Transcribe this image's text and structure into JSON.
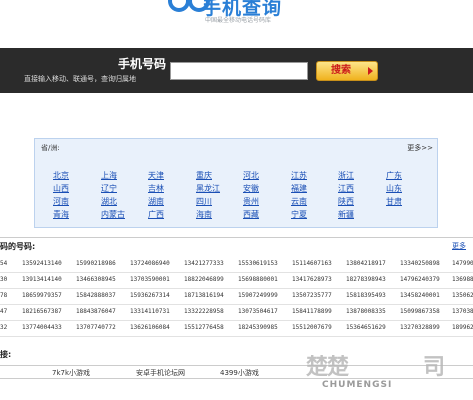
{
  "header": {
    "logo_text": "手机查询",
    "logo_subtitle": "中国最全移动电话号码库"
  },
  "search": {
    "title": "手机号码",
    "hint": "直接输入移动、联通号，查询归属地",
    "input_value": "",
    "button_label": "搜索"
  },
  "provinces": {
    "label": "省/洲:",
    "more": "更多>>",
    "rows": [
      [
        "北京",
        "上海",
        "天津",
        "重庆",
        "河北",
        "江苏",
        "浙江",
        "广东"
      ],
      [
        "山西",
        "辽宁",
        "吉林",
        "黑龙江",
        "安徽",
        "福建",
        "江西",
        "山东"
      ],
      [
        "河南",
        "湖北",
        "湖南",
        "四川",
        "贵州",
        "云南",
        "陕西",
        "甘肃"
      ],
      [
        "青海",
        "内蒙古",
        "广西",
        "海南",
        "西藏",
        "宁夏",
        "新疆"
      ]
    ]
  },
  "numbers": {
    "title": "码的号码:",
    "more": "更多",
    "rows": [
      [
        "54",
        "13592413140",
        "15990218986",
        "13724086940",
        "13421277333",
        "15530619153",
        "15114607163",
        "13804218917",
        "13340250898",
        "147990"
      ],
      [
        "30",
        "13913414140",
        "13466308945",
        "13703590001",
        "18822046899",
        "15698880001",
        "13417628973",
        "18278398943",
        "14796240379",
        "136988"
      ],
      [
        "78",
        "18659979357",
        "15842888037",
        "15936267314",
        "18713816194",
        "15907249999",
        "13507235777",
        "15818395493",
        "13458240001",
        "135062"
      ],
      [
        "47",
        "18216567387",
        "18843876047",
        "13314110731",
        "13322228958",
        "13073504617",
        "15841178899",
        "13878008335",
        "15099867358",
        "137038"
      ],
      [
        "32",
        "13774004433",
        "13707740772",
        "13626106084",
        "15512776458",
        "18245390985",
        "15512007679",
        "15364651629",
        "13270328899",
        "189962"
      ]
    ]
  },
  "links": {
    "title": "接:",
    "items": [
      "7k7k小游戏",
      "安卓手机论坛网",
      "4399小游戏"
    ]
  },
  "watermark": {
    "glyphs": "楚楚",
    "glyph2": "司",
    "text": "CHUMENGSI"
  },
  "colors": {
    "brand": "#2a7fd6",
    "search_bar": "#2b2b2b",
    "button": "#f0b21e",
    "link": "#1a4fb5",
    "province_box": "#e9f1fb"
  }
}
